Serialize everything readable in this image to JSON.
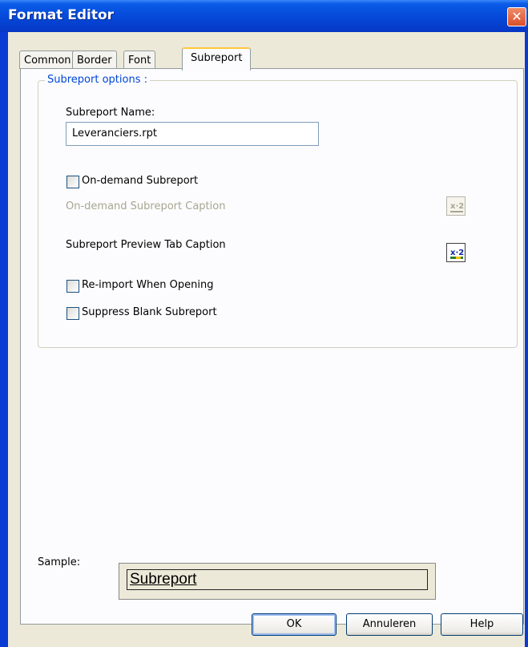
{
  "window": {
    "title": "Format Editor",
    "close_glyph": "✕",
    "colors": {
      "titlebar": "#0546d6",
      "dialog_bg": "#ece9d8",
      "group_title": "#0046d5",
      "close_button": "#d9502a"
    }
  },
  "tabs": [
    {
      "label": "Common"
    },
    {
      "label": "Border"
    },
    {
      "label": "Font"
    },
    {
      "label": "Subreport",
      "active": true
    }
  ],
  "subreport_options": {
    "group_title": "Subreport options :",
    "name_label": "Subreport Name:",
    "name_value": "Leveranciers.rpt",
    "on_demand_label": "On-demand Subreport",
    "on_demand_checked": false,
    "on_demand_caption_label": "On-demand Subreport Caption",
    "on_demand_caption_enabled": false,
    "formula_button_icon": "formula-x2-icon",
    "preview_tab_caption_label": "Subreport Preview Tab Caption",
    "reimport_label": "Re-import When Opening",
    "reimport_checked": false,
    "suppress_blank_label": "Suppress Blank Subreport",
    "suppress_blank_checked": false
  },
  "sample": {
    "label": "Sample:",
    "text": "Subreport"
  },
  "buttons": {
    "ok": "OK",
    "cancel": "Annuleren",
    "help": "Help"
  }
}
